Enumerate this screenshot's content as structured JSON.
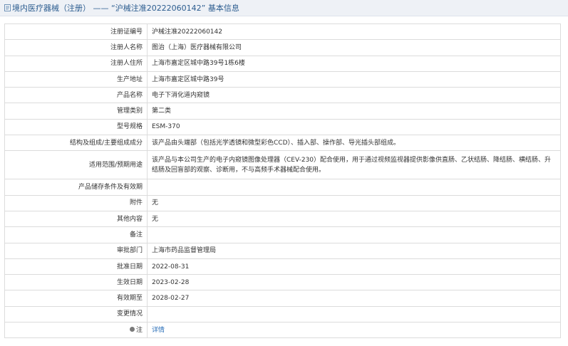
{
  "header": {
    "title": "境内医疗器械（注册） —— “沪械注准20222060142” 基本信息"
  },
  "rows": [
    {
      "label": "注册证编号",
      "value": "沪械注准20222060142"
    },
    {
      "label": "注册人名称",
      "value": "图治（上海）医疗器械有限公司"
    },
    {
      "label": "注册人住所",
      "value": "上海市嘉定区城中路39号1栋6楼"
    },
    {
      "label": "生产地址",
      "value": "上海市嘉定区城中路39号"
    },
    {
      "label": "产品名称",
      "value": "电子下消化道内窥镜"
    },
    {
      "label": "管理类别",
      "value": "第二类"
    },
    {
      "label": "型号规格",
      "value": "ESM-370"
    },
    {
      "label": "结构及组成/主要组成成分",
      "value": "该产品由头端部（包括光学透镜和微型彩色CCD）、插入部、操作部、导光插头部组成。"
    },
    {
      "label": "适用范围/预期用途",
      "value": "该产品与本公司生产的电子内窥镜图像处理器（CEV-230）配合使用，用于通过视频监视器提供影像供直肠、乙状结肠、降结肠、横结肠、升结肠及回盲部的观察、诊断用，不与高频手术器械配合使用。"
    },
    {
      "label": "产品储存条件及有效期",
      "value": ""
    },
    {
      "label": "附件",
      "value": "无"
    },
    {
      "label": "其他内容",
      "value": "无"
    },
    {
      "label": "备注",
      "value": ""
    },
    {
      "label": "审批部门",
      "value": "上海市药品监督管理局"
    },
    {
      "label": "批准日期",
      "value": "2022-08-31"
    },
    {
      "label": "生效日期",
      "value": "2023-02-28"
    },
    {
      "label": "有效期至",
      "value": "2028-02-27"
    },
    {
      "label": "变更情况",
      "value": ""
    }
  ],
  "note": {
    "label": "注",
    "link_text": "详情"
  },
  "colors": {
    "header_bg": "#eef1f6",
    "header_text": "#2b5c8f",
    "border": "#dcdcdc",
    "link": "#2a6fb8"
  }
}
